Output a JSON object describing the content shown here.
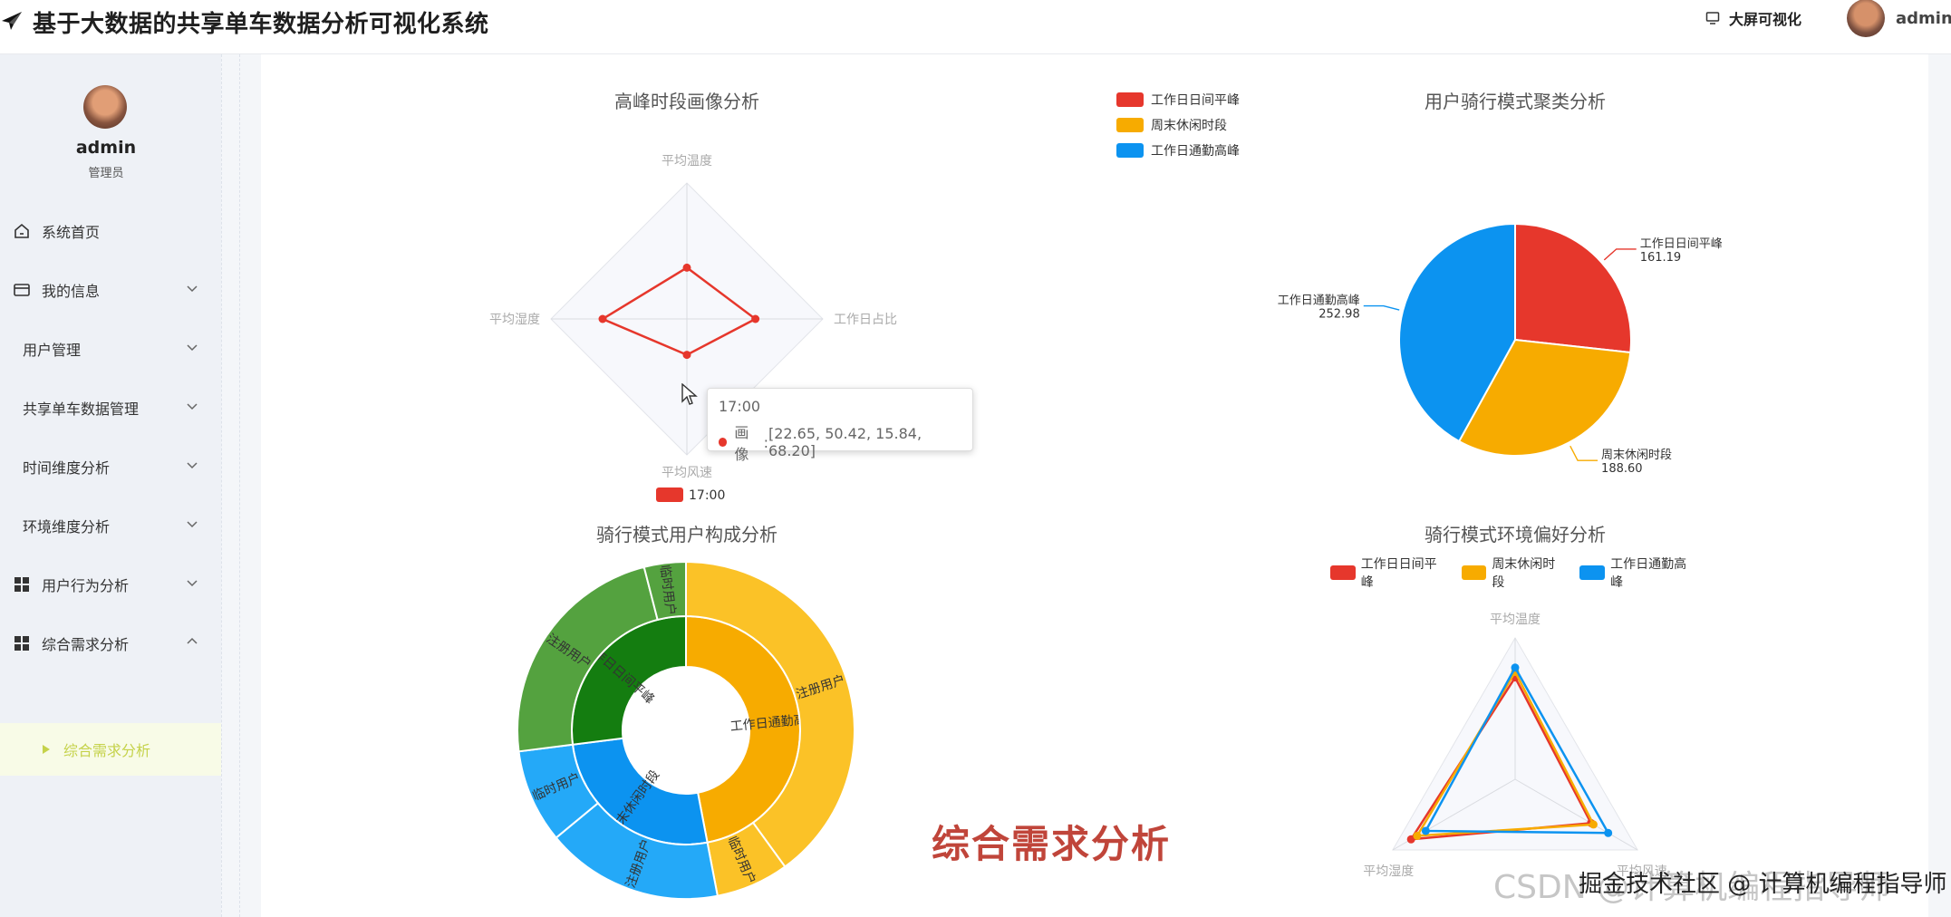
{
  "app": {
    "title": "基于大数据的共享单车数据分析可视化系统",
    "big_screen_label": "大屏可视化",
    "user_name": "admin"
  },
  "sidebar": {
    "user_name": "admin",
    "role": "管理员",
    "items": [
      {
        "label": "系统首页",
        "icon": "home-icon",
        "has_chevron": false
      },
      {
        "label": "我的信息",
        "icon": "card-icon",
        "has_chevron": true
      },
      {
        "label": "用户管理",
        "icon": "",
        "has_chevron": true
      },
      {
        "label": "共享单车数据管理",
        "icon": "",
        "has_chevron": true
      },
      {
        "label": "时间维度分析",
        "icon": "",
        "has_chevron": true
      },
      {
        "label": "环境维度分析",
        "icon": "",
        "has_chevron": true
      },
      {
        "label": "用户行为分析",
        "icon": "grid-icon",
        "has_chevron": true
      },
      {
        "label": "综合需求分析",
        "icon": "grid-icon",
        "has_chevron": true,
        "expanded": true
      }
    ],
    "active_sub": "综合需求分析",
    "active_color": "#c5d24a"
  },
  "colors": {
    "red": "#e6372c",
    "orange": "#f7ab00",
    "blue": "#0c93f0",
    "green": "#54a23f",
    "dark_green": "#147d10",
    "light_blue": "#24a9f8",
    "gold": "#fbc227"
  },
  "chart_data": [
    {
      "type": "radar",
      "title": "高峰时段画像分析",
      "indicators": [
        "平均温度",
        "工作日占比",
        "平均风速",
        "平均湿度"
      ],
      "series": [
        {
          "name": "17:00",
          "values": [
            22.65,
            50.42,
            15.84,
            68.2
          ]
        }
      ],
      "legend": [
        "17:00"
      ],
      "legend_position": "bottom",
      "tooltip": {
        "title": "17:00",
        "series_label": "画像",
        "value_text": "[22.65, 50.42, 15.84, 68.20]"
      }
    },
    {
      "type": "pie",
      "title": "用户骑行模式聚类分析",
      "legend": [
        "工作日日间平峰",
        "周末休闲时段",
        "工作日通勤高峰"
      ],
      "legend_position": "top-left",
      "slices": [
        {
          "name": "工作日日间平峰",
          "value": 161.19,
          "label": "161.19"
        },
        {
          "name": "周末休闲时段",
          "value": 188.6,
          "label": "188.60"
        },
        {
          "name": "工作日通勤高峰",
          "value": 252.98,
          "label": "252.98"
        }
      ]
    },
    {
      "type": "sunburst",
      "title": "骑行模式用户构成分析",
      "inner": [
        {
          "name": "工作日通勤高峰",
          "value": 47
        },
        {
          "name": "周末休闲时段",
          "value": 26
        },
        {
          "name": "工作日日间平峰",
          "value": 27
        }
      ],
      "outer": [
        {
          "parent": "工作日通勤高峰",
          "name": "注册用户",
          "value": 40
        },
        {
          "parent": "工作日通勤高峰",
          "name": "临时用户",
          "value": 7
        },
        {
          "parent": "周末休闲时段",
          "name": "注册用户",
          "value": 17
        },
        {
          "parent": "周末休闲时段",
          "name": "临时用户",
          "value": 9
        },
        {
          "parent": "工作日日间平峰",
          "name": "注册用户",
          "value": 23
        },
        {
          "parent": "工作日日间平峰",
          "name": "临时用户",
          "value": 4
        }
      ],
      "center_label": "综合需求分析"
    },
    {
      "type": "radar",
      "title": "骑行模式环境偏好分析",
      "legend": [
        "工作日日间平峰",
        "周末休闲时段",
        "工作日通勤高峰"
      ],
      "legend_position": "top",
      "indicators": [
        "平均温度",
        "平均风速",
        "平均湿度"
      ],
      "series": [
        {
          "name": "工作日日间平峰",
          "values": [
            0.72,
            0.62,
            0.85
          ]
        },
        {
          "name": "周末休闲时段",
          "values": [
            0.76,
            0.64,
            0.8
          ]
        },
        {
          "name": "工作日通勤高峰",
          "values": [
            0.79,
            0.76,
            0.73
          ]
        }
      ]
    }
  ],
  "watermark": "CSDN @计算机编程指导师",
  "watermark2": "掘金技术社区 @ 计算机编程指导师"
}
